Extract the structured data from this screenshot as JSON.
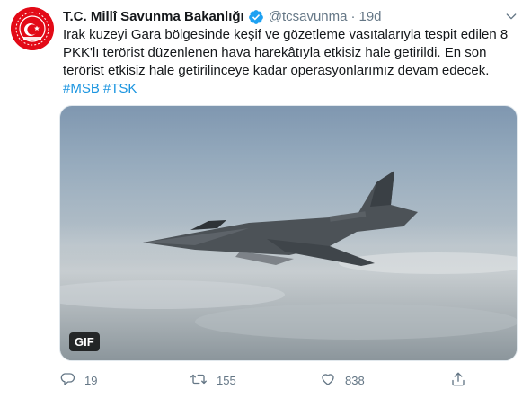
{
  "tweet": {
    "display_name": "T.C. Millî Savunma Bakanlığı",
    "handle": "@tcsavunma",
    "separator": "·",
    "time": "19d",
    "text_lines": [
      "Irak kuzeyi Gara bölgesinde keşif ve gözetleme vasıtalarıyla tespit edilen 8",
      "PKK'lı terörist düzenlenen hava harekâtıyla etkisiz hale getirildi. En son",
      "terörist etkisiz hale getirilinceye kadar operasyonlarımız devam edecek."
    ],
    "hashtags": [
      "#MSB",
      "#TSK"
    ],
    "media_badge": "GIF"
  },
  "actions": {
    "reply_count": "19",
    "retweet_count": "155",
    "like_count": "838"
  },
  "icons": {
    "avatar": "ministry-emblem",
    "verified": "verified-badge-icon",
    "caret": "chevron-down-icon",
    "reply": "reply-icon",
    "retweet": "retweet-icon",
    "like": "heart-icon",
    "share": "share-icon"
  },
  "colors": {
    "brand_red": "#e30a17",
    "link_blue": "#1b95e0",
    "secondary_text": "#657786"
  }
}
